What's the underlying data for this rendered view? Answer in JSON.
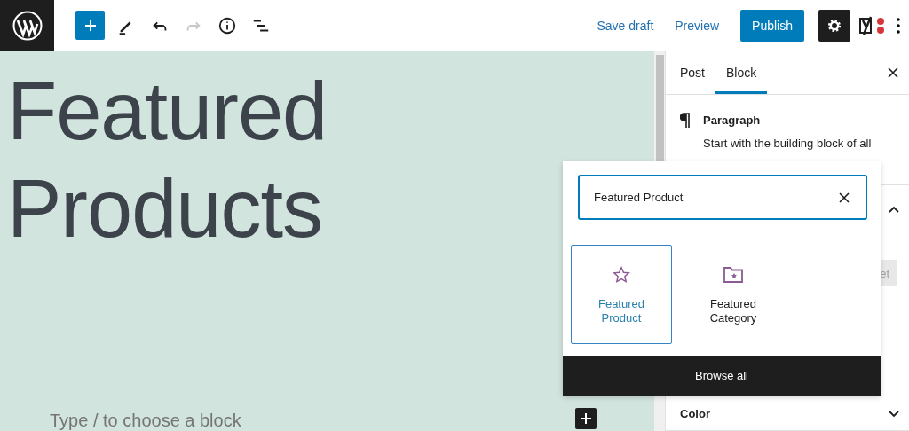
{
  "toolbar": {
    "left": [
      {
        "kind": "add",
        "selected": false
      },
      {
        "kind": "edit",
        "disabled": false
      },
      {
        "kind": "undo",
        "disabled": false
      },
      {
        "kind": "redo",
        "disabled": true
      },
      {
        "kind": "info",
        "disabled": false
      },
      {
        "kind": "list",
        "disabled": false
      }
    ],
    "links": [
      "Save draft",
      "Preview"
    ],
    "publish": "Publish",
    "settings": {
      "selected": true
    }
  },
  "canvas": {
    "title_lines": [
      "Featured",
      "Products"
    ],
    "placeholder": "Type / to choose a block"
  },
  "sidebar": {
    "tabs": [
      {
        "label": "Post",
        "selected": false
      },
      {
        "label": "Block",
        "selected": true
      }
    ],
    "block": {
      "name": "Paragraph",
      "description": "Start with the building block of all"
    },
    "panels": [
      {
        "kind": "open",
        "button": "et"
      },
      {
        "kind": "closed",
        "label": "Color"
      }
    ]
  },
  "inserter": {
    "search": {
      "value": "Featured Product"
    },
    "results": [
      {
        "label": "Featured Product",
        "kind": "star",
        "selected": true
      },
      {
        "label": "Featured Category",
        "kind": "folder",
        "selected": false
      }
    ],
    "browse": "Browse all"
  }
}
